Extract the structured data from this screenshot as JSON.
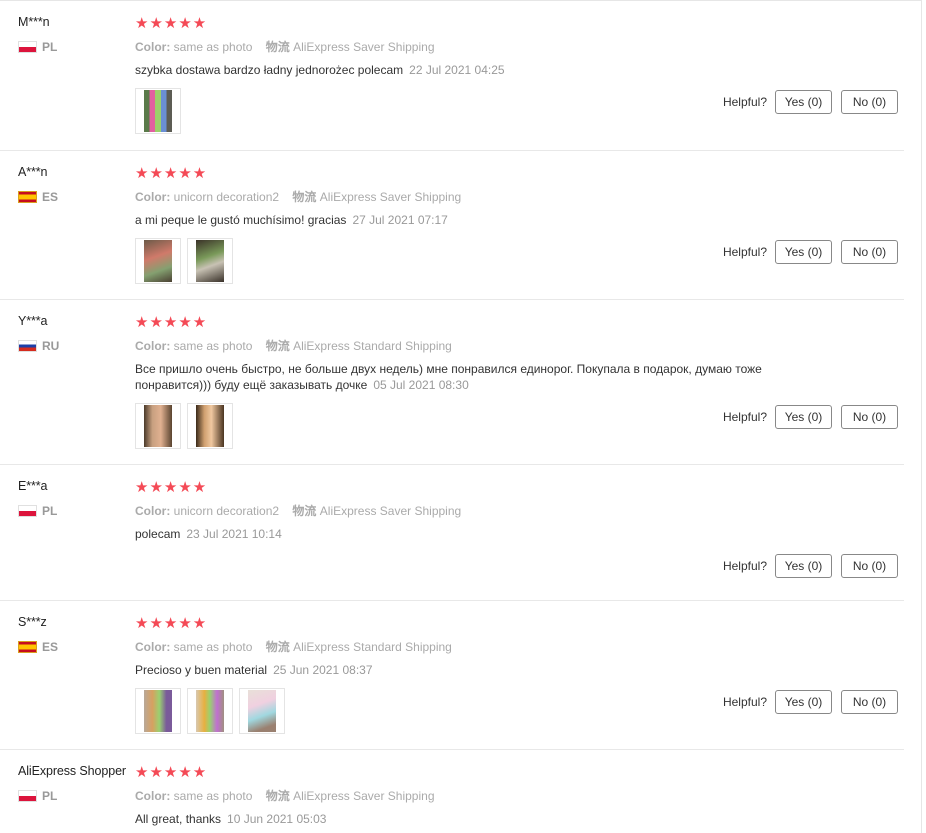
{
  "helpful_label": "Helpful?",
  "colors": {
    "star": "#f44a56",
    "divider": "#e8e8e8",
    "meta_text": "#aaaaaa"
  },
  "reviews": [
    {
      "user": "M***n",
      "country": "PL",
      "flag": "pl",
      "stars": "★★★★★",
      "rating": 5,
      "color_key": "Color:",
      "color_value": "same as photo",
      "ship_key": "物流",
      "ship_value": "AliExpress Saver Shipping",
      "text": "szybka dostawa bardzo ładny jednorożec polecam",
      "date": "22 Jul 2021 04:25",
      "photos": [
        "img-a"
      ],
      "yes": "Yes (0)",
      "no": "No (0)"
    },
    {
      "user": "A***n",
      "country": "ES",
      "flag": "es",
      "stars": "★★★★★",
      "rating": 5,
      "color_key": "Color:",
      "color_value": "unicorn decoration2",
      "ship_key": "物流",
      "ship_value": "AliExpress Saver Shipping",
      "text": "a mi peque le gustó muchísimo! gracias",
      "date": "27 Jul 2021 07:17",
      "photos": [
        "img-b",
        "img-c"
      ],
      "yes": "Yes (0)",
      "no": "No (0)"
    },
    {
      "user": "Y***a",
      "country": "RU",
      "flag": "ru",
      "stars": "★★★★★",
      "rating": 5,
      "color_key": "Color:",
      "color_value": "same as photo",
      "ship_key": "物流",
      "ship_value": "AliExpress Standard Shipping",
      "text": "Все пришло очень быстро, не больше двух недель) мне понравился единорог. Покупала в подарок, думаю тоже понравится))) буду ещё заказывать дочке",
      "date": "05 Jul 2021 08:30",
      "photos": [
        "img-d",
        "img-e"
      ],
      "yes": "Yes (0)",
      "no": "No (0)"
    },
    {
      "user": "E***a",
      "country": "PL",
      "flag": "pl",
      "stars": "★★★★★",
      "rating": 5,
      "color_key": "Color:",
      "color_value": "unicorn decoration2",
      "ship_key": "物流",
      "ship_value": "AliExpress Saver Shipping",
      "text": "polecam",
      "date": "23 Jul 2021 10:14",
      "photos": [],
      "yes": "Yes (0)",
      "no": "No (0)"
    },
    {
      "user": "S***z",
      "country": "ES",
      "flag": "es",
      "stars": "★★★★★",
      "rating": 5,
      "color_key": "Color:",
      "color_value": "same as photo",
      "ship_key": "物流",
      "ship_value": "AliExpress Standard Shipping",
      "text": "Precioso y buen material",
      "date": "25 Jun 2021 08:37",
      "photos": [
        "img-f",
        "img-g",
        "img-h"
      ],
      "yes": "Yes (0)",
      "no": "No (0)"
    },
    {
      "user": "AliExpress Shopper",
      "country": "PL",
      "flag": "pl",
      "stars": "★★★★★",
      "rating": 5,
      "color_key": "Color:",
      "color_value": "same as photo",
      "ship_key": "物流",
      "ship_value": "AliExpress Saver Shipping",
      "text": "All great, thanks",
      "date": "10 Jun 2021 05:03",
      "photos": [],
      "yes": null,
      "no": null
    }
  ]
}
